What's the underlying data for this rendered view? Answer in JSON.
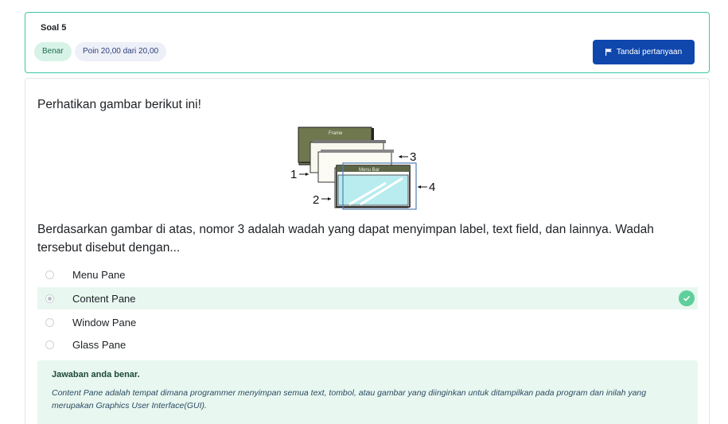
{
  "header": {
    "question_number": "Soal 5",
    "status_badge": "Benar",
    "points_badge": "Poin 20,00 dari 20,00",
    "flag_button": "Tandai pertanyaan"
  },
  "question": {
    "prompt": "Perhatikan gambar berikut ini!",
    "figure": {
      "frame_label": "Frame",
      "menubar_label": "Menu Bar",
      "callouts": [
        "1",
        "2",
        "3",
        "4"
      ]
    },
    "text": "Berdasarkan gambar di atas, nomor 3 adalah wadah yang dapat menyimpan label, text field, dan lainnya. Wadah tersebut disebut dengan...",
    "options": [
      {
        "label": "Menu Pane",
        "selected": false
      },
      {
        "label": "Content Pane",
        "selected": true
      },
      {
        "label": "Window Pane",
        "selected": false
      },
      {
        "label": "Glass Pane",
        "selected": false
      }
    ]
  },
  "feedback": {
    "title": "Jawaban anda benar.",
    "text": "Content Pane adalah tempat dimana programmer menyimpan semua text, tombol, atau gambar yang diinginkan untuk ditampilkan pada program dan inilah yang merupakan Graphics User Interface(GUI)."
  },
  "colors": {
    "accent": "#0f47ad",
    "correct_border": "#3cc7a4",
    "correct_bg": "#e8f7f0",
    "check": "#5fcf9b"
  }
}
